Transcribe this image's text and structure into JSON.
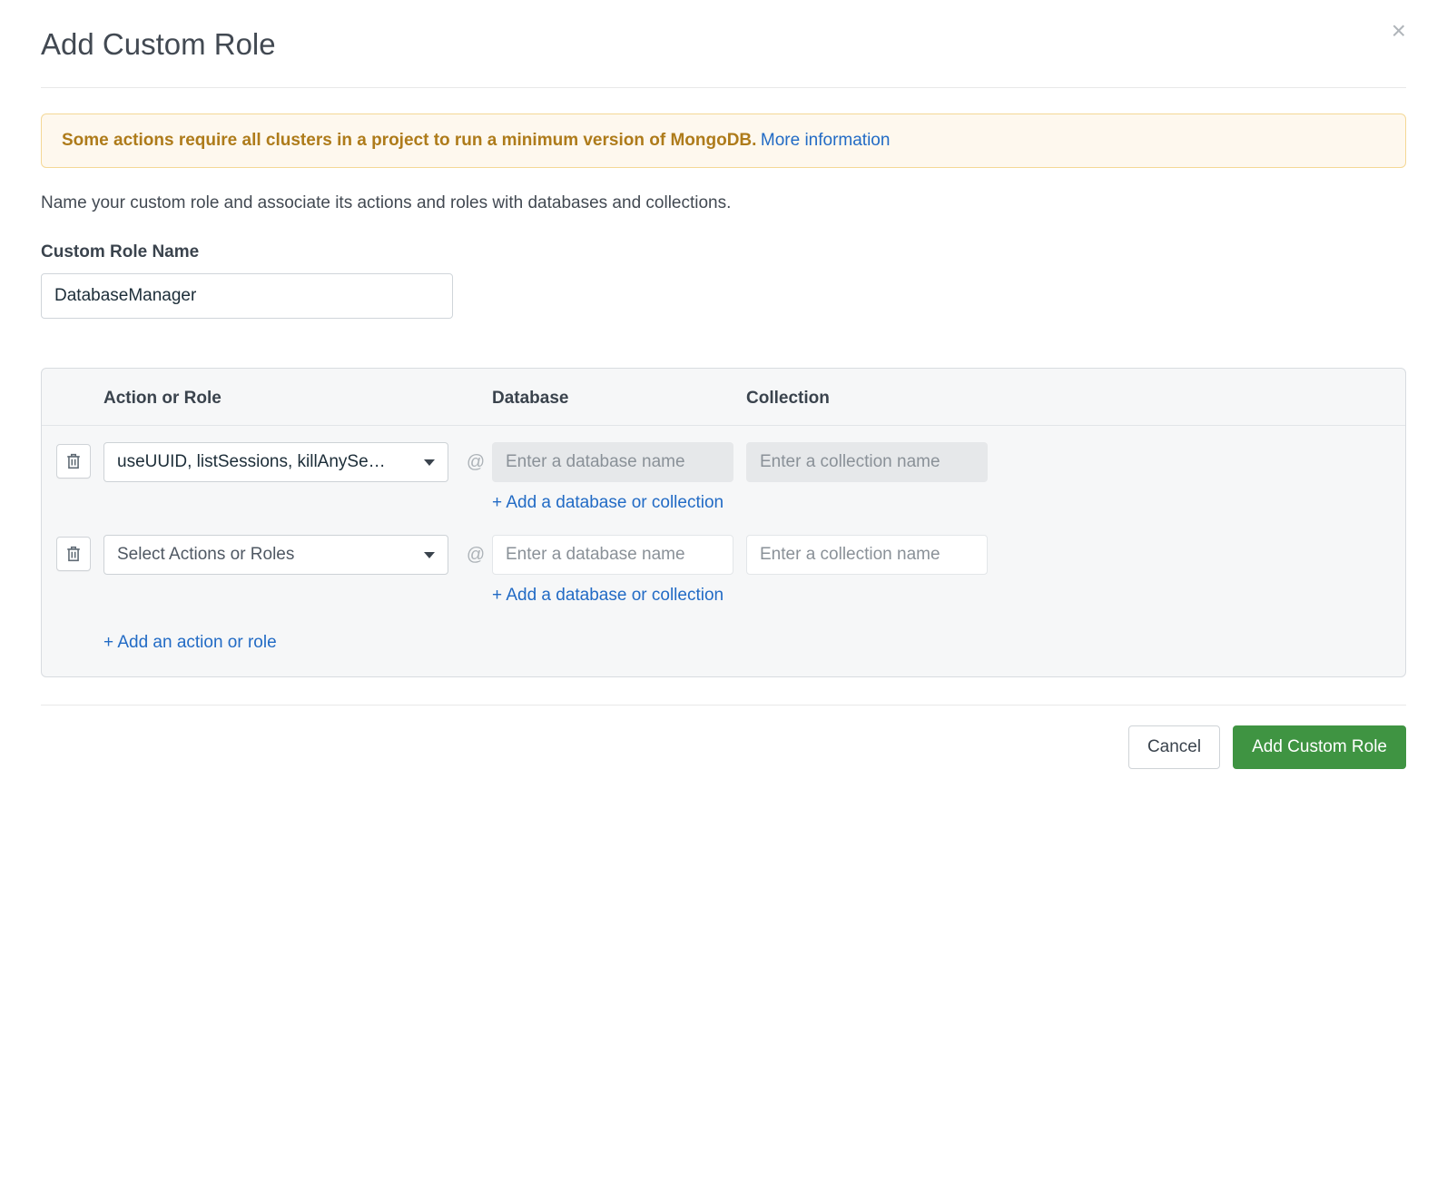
{
  "title": "Add Custom Role",
  "alert": {
    "text": "Some actions require all clusters in a project to run a minimum version of MongoDB.",
    "link": "More information"
  },
  "description": "Name your custom role and associate its actions and roles with databases and collections.",
  "role_name": {
    "label": "Custom Role Name",
    "value": "DatabaseManager"
  },
  "headers": {
    "action": "Action or Role",
    "database": "Database",
    "collection": "Collection"
  },
  "rows": [
    {
      "action_value": "useUUID, listSessions, killAnySe…",
      "action_placeholder": "Select Actions or Roles",
      "db_placeholder": "Enter a database name",
      "coll_placeholder": "Enter a collection name",
      "db_disabled": true,
      "coll_disabled": true
    },
    {
      "action_value": "",
      "action_placeholder": "Select Actions or Roles",
      "db_placeholder": "Enter a database name",
      "coll_placeholder": "Enter a collection name",
      "db_disabled": false,
      "coll_disabled": false
    }
  ],
  "links": {
    "add_db": "+ Add a database or collection",
    "add_action": "+ Add an action or role"
  },
  "buttons": {
    "cancel": "Cancel",
    "submit": "Add Custom Role"
  }
}
